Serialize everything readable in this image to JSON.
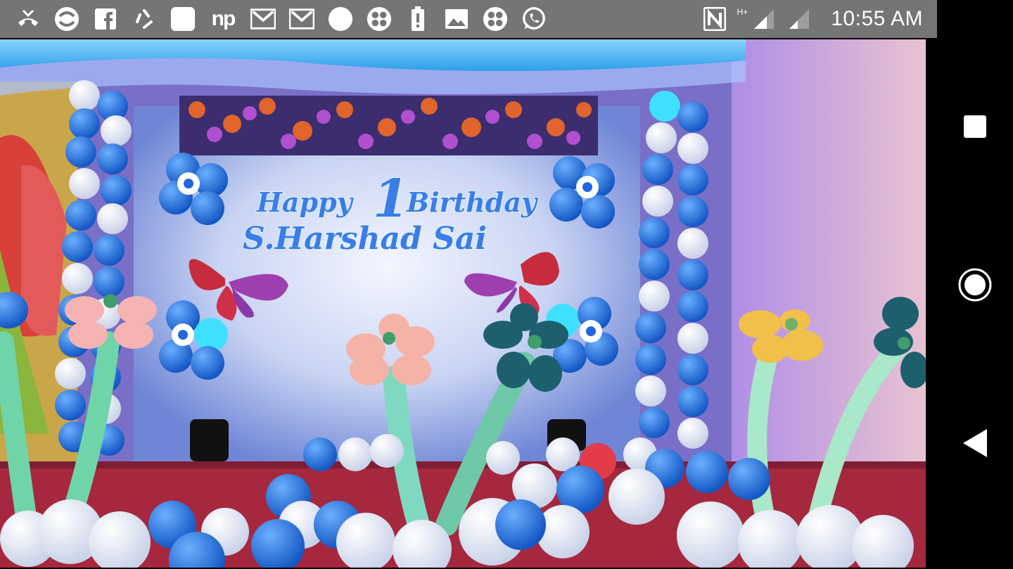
{
  "status_bar": {
    "time": "10:55 AM",
    "network_type": "H+",
    "notification_icons": [
      "missed-call-icon",
      "sync-icon",
      "facebook-icon",
      "recycle-icon",
      "app-square-icon",
      "np-icon",
      "gmail-icon",
      "gmail-icon",
      "circle-icon",
      "four-dots-icon",
      "battery-alert-icon",
      "image-icon",
      "four-dots-icon",
      "whatsapp-icon"
    ],
    "np_label": "np"
  },
  "photo": {
    "banner": {
      "line1_left": "Happy",
      "line1_number": "1",
      "line1_right": "Birthday",
      "line2": "S.Harshad Sai"
    }
  },
  "nav_bar": {
    "buttons": [
      "recents-button",
      "home-button",
      "back-button"
    ]
  },
  "colors": {
    "status_bar": "#757575",
    "nav_bar": "#000000",
    "balloon_blue": "#1f6fd6",
    "carpet_red": "#a5283f"
  }
}
